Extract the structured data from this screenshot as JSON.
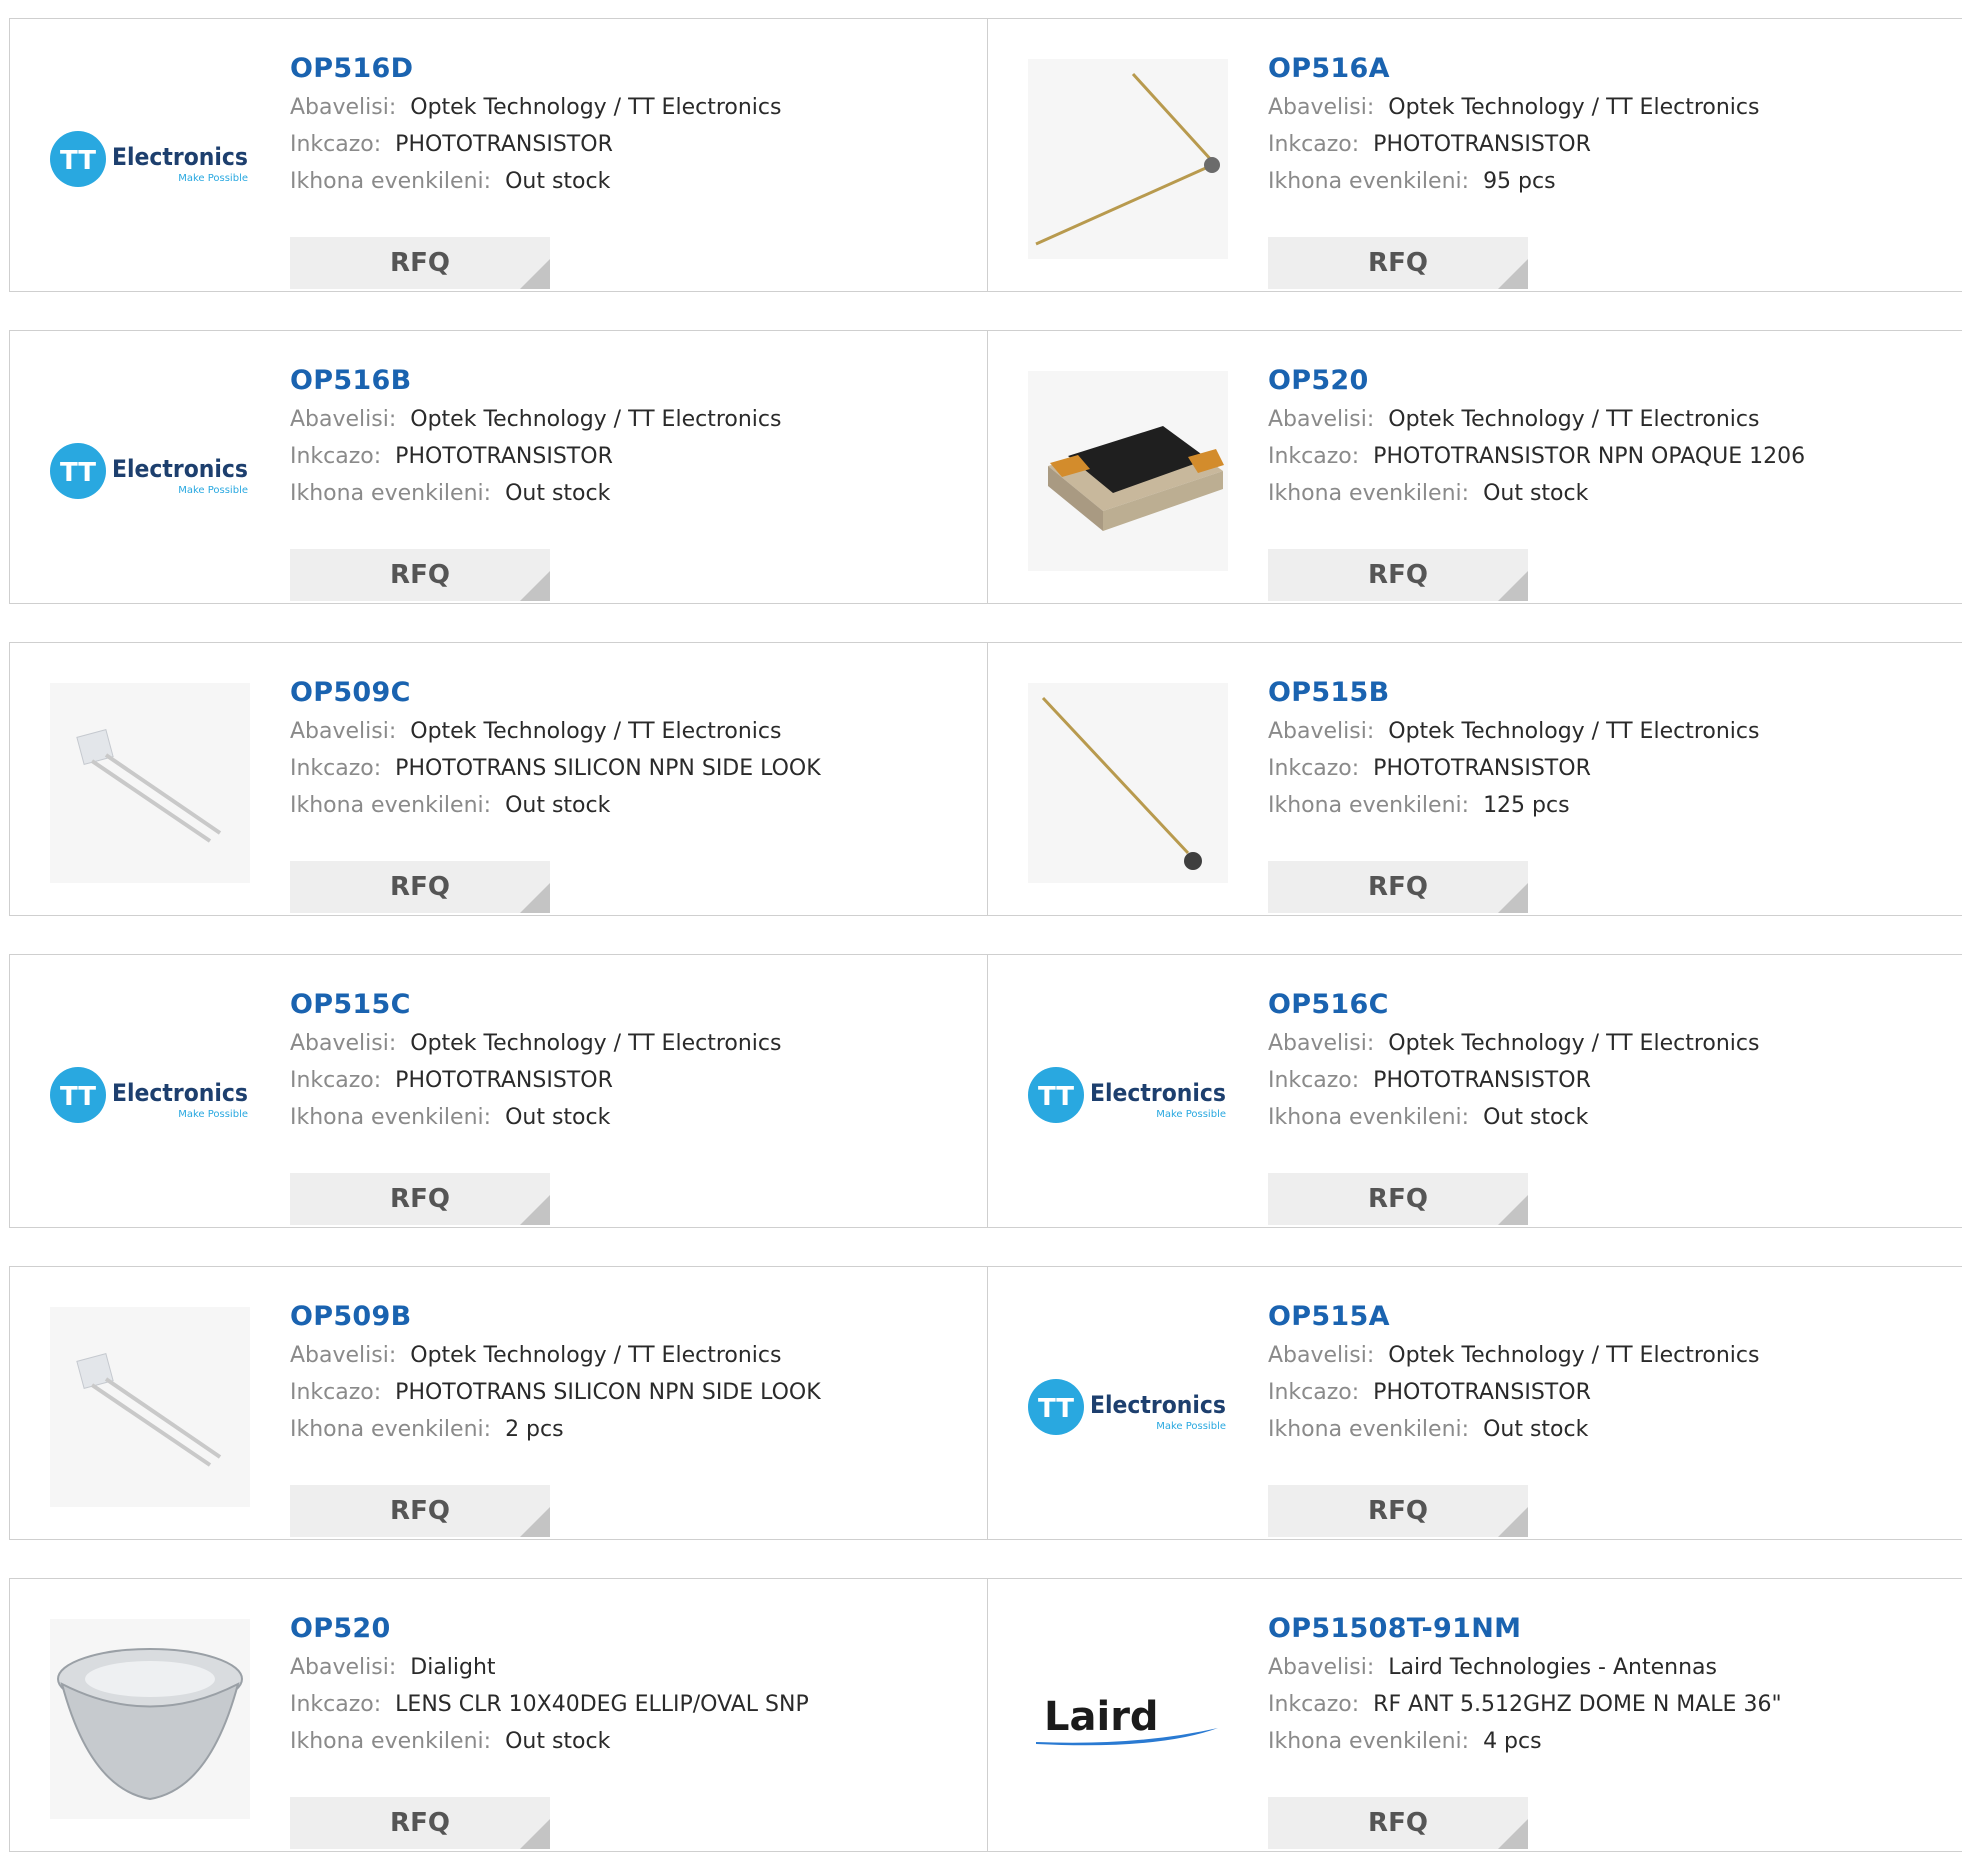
{
  "labels": {
    "manufacturer": "Abavelisi:",
    "description": "Inkcazo:",
    "stock": "Ikhona evenkileni:",
    "rfq": "RFQ"
  },
  "logos": {
    "tt_brand": "Electronics",
    "tt_tagline": "Make Possible",
    "tt_badge": "TT",
    "laird": "Laird"
  },
  "products": [
    {
      "part": "OP516D",
      "manufacturer": "Optek Technology / TT Electronics",
      "description": "PHOTOTRANSISTOR",
      "stock": "Out stock",
      "image": "tt-electronics-logo"
    },
    {
      "part": "OP516A",
      "manufacturer": "Optek Technology / TT Electronics",
      "description": "PHOTOTRANSISTOR",
      "stock": "95 pcs",
      "image": "long-lead-phototransistor-photo"
    },
    {
      "part": "OP516B",
      "manufacturer": "Optek Technology / TT Electronics",
      "description": "PHOTOTRANSISTOR",
      "stock": "Out stock",
      "image": "tt-electronics-logo"
    },
    {
      "part": "OP520",
      "manufacturer": "Optek Technology / TT Electronics",
      "description": "PHOTOTRANSISTOR NPN OPAQUE 1206",
      "stock": "Out stock",
      "image": "smd-1206-chip-photo"
    },
    {
      "part": "OP509C",
      "manufacturer": "Optek Technology / TT Electronics",
      "description": "PHOTOTRANS SILICON NPN SIDE LOOK",
      "stock": "Out stock",
      "image": "side-look-component-photo"
    },
    {
      "part": "OP515B",
      "manufacturer": "Optek Technology / TT Electronics",
      "description": "PHOTOTRANSISTOR",
      "stock": "125 pcs",
      "image": "single-lead-phototransistor-photo"
    },
    {
      "part": "OP515C",
      "manufacturer": "Optek Technology / TT Electronics",
      "description": "PHOTOTRANSISTOR",
      "stock": "Out stock",
      "image": "tt-electronics-logo"
    },
    {
      "part": "OP516C",
      "manufacturer": "Optek Technology / TT Electronics",
      "description": "PHOTOTRANSISTOR",
      "stock": "Out stock",
      "image": "tt-electronics-logo"
    },
    {
      "part": "OP509B",
      "manufacturer": "Optek Technology / TT Electronics",
      "description": "PHOTOTRANS SILICON NPN SIDE LOOK",
      "stock": "2 pcs",
      "image": "side-look-component-photo"
    },
    {
      "part": "OP515A",
      "manufacturer": "Optek Technology / TT Electronics",
      "description": "PHOTOTRANSISTOR",
      "stock": "Out stock",
      "image": "tt-electronics-logo"
    },
    {
      "part": "OP520",
      "manufacturer": "Dialight",
      "description": "LENS CLR 10X40DEG ELLIP/OVAL SNP",
      "stock": "Out stock",
      "image": "clear-lens-photo"
    },
    {
      "part": "OP51508T-91NM",
      "manufacturer": "Laird Technologies - Antennas",
      "description": "RF ANT 5.512GHZ DOME N MALE 36\"",
      "stock": "4 pcs",
      "image": "laird-logo"
    }
  ],
  "colors": {
    "title_link": "#1a63b0",
    "label": "#8a8a8a",
    "value": "#2a2a2a",
    "rfq_bg": "#eeeeee",
    "rfq_text": "#555555",
    "border": "#cfcfcf",
    "tt_blue": "#29a8e0",
    "tt_navy": "#1d3f6e"
  }
}
